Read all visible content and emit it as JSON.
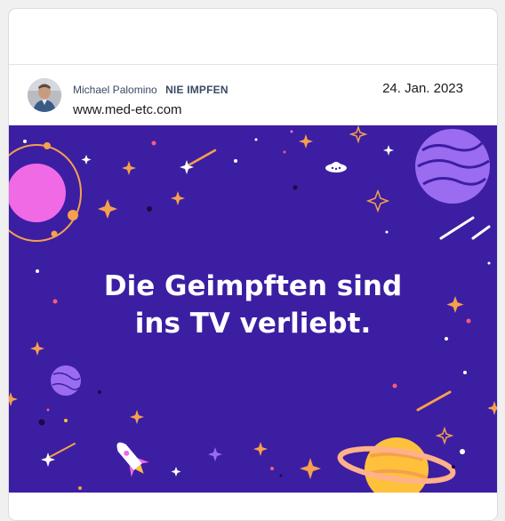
{
  "post": {
    "author_name": "Michael Palomino",
    "author_tag": "NIE IMPFEN",
    "site": "www.med-etc.com",
    "date": "24. Jan. 2023"
  },
  "banner": {
    "headline_line1": "Die Geimpften sind",
    "headline_line2": "ins TV verliebt.",
    "background_color": "#3c1ea3"
  },
  "colors": {
    "author_text": "#3a4a66",
    "star_orange": "#f6a04d",
    "planet_pink": "#f06ae6",
    "planet_purple": "#9b6cf0",
    "planet_yellow": "#ffc13c"
  }
}
